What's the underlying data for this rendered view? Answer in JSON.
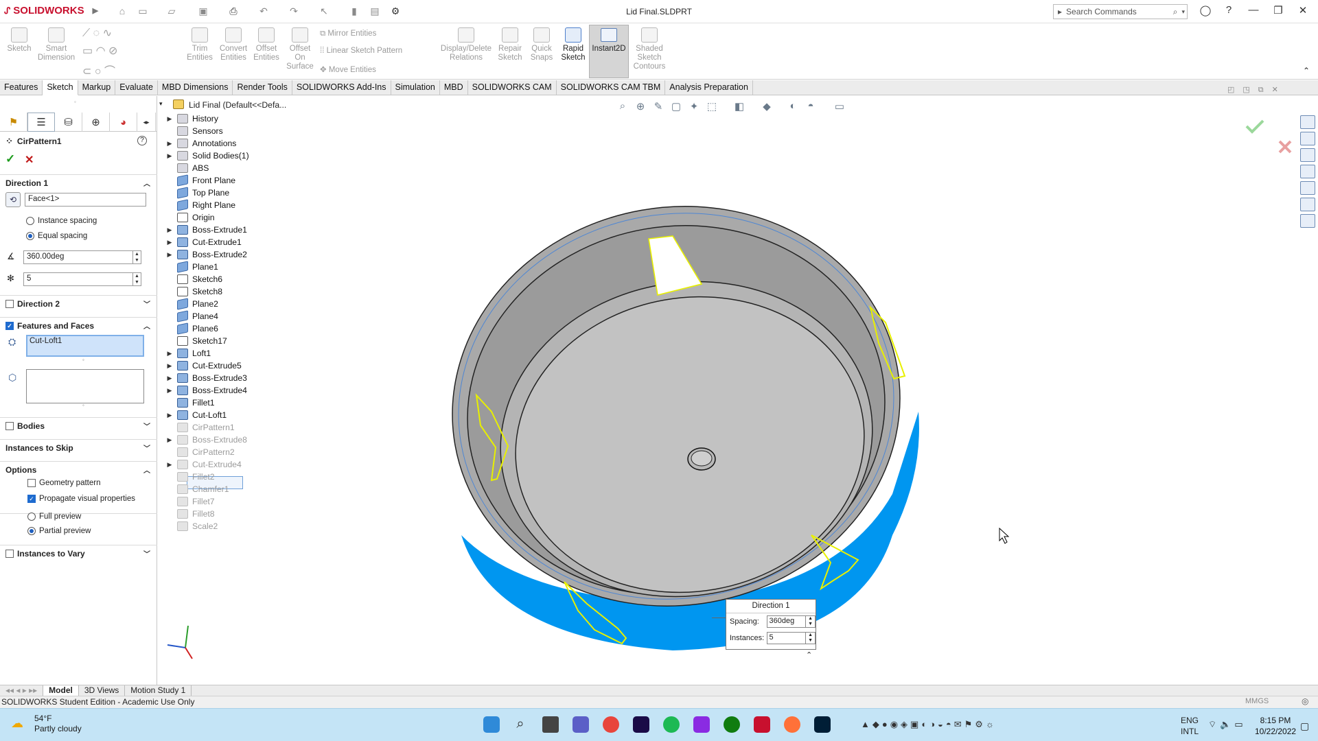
{
  "app": {
    "brand": "SOLIDWORKS",
    "title": "Lid Final.SLDPRT"
  },
  "search": {
    "placeholder": "Search Commands"
  },
  "ribbon": {
    "sketch": "Sketch",
    "smart_dimension": "Smart\nDimension",
    "trim": "Trim\nEntities",
    "convert": "Convert\nEntities",
    "offset": "Offset\nEntities",
    "offset_surface": "Offset\nOn\nSurface",
    "mirror": "Mirror Entities",
    "linear_pattern": "Linear Sketch Pattern",
    "move": "Move Entities",
    "display_delete": "Display/Delete\nRelations",
    "repair": "Repair\nSketch",
    "quick_snaps": "Quick\nSnaps",
    "rapid_sketch": "Rapid\nSketch",
    "instant2d": "Instant2D",
    "shaded": "Shaded\nSketch\nContours"
  },
  "tabs": [
    "Features",
    "Sketch",
    "Markup",
    "Evaluate",
    "MBD Dimensions",
    "Render Tools",
    "SOLIDWORKS Add-Ins",
    "Simulation",
    "MBD",
    "SOLIDWORKS CAM",
    "SOLIDWORKS CAM TBM",
    "Analysis Preparation"
  ],
  "pm": {
    "title": "CirPattern1",
    "direction1": "Direction 1",
    "axis_value": "Face<1>",
    "instance_spacing": "Instance spacing",
    "equal_spacing": "Equal spacing",
    "angle": "360.00deg",
    "instances": "5",
    "direction2": "Direction 2",
    "features_faces": "Features and Faces",
    "feature_item": "Cut-Loft1",
    "bodies": "Bodies",
    "instances_skip": "Instances to Skip",
    "options": "Options",
    "geometry_pattern": "Geometry pattern",
    "propagate": "Propagate visual properties",
    "full_preview": "Full preview",
    "partial_preview": "Partial preview",
    "instances_vary": "Instances to Vary"
  },
  "tree": {
    "root": "Lid Final  (Default<<Defa...",
    "items": [
      {
        "label": "History",
        "icon": "folder"
      },
      {
        "label": "Sensors",
        "icon": "folder"
      },
      {
        "label": "Annotations",
        "icon": "folder"
      },
      {
        "label": "Solid Bodies(1)",
        "icon": "folder"
      },
      {
        "label": "ABS",
        "icon": "folder"
      },
      {
        "label": "Front Plane",
        "icon": "plane"
      },
      {
        "label": "Top Plane",
        "icon": "plane"
      },
      {
        "label": "Right Plane",
        "icon": "plane"
      },
      {
        "label": "Origin",
        "icon": "origin"
      },
      {
        "label": "Boss-Extrude1",
        "icon": "feat"
      },
      {
        "label": "Cut-Extrude1",
        "icon": "feat"
      },
      {
        "label": "Boss-Extrude2",
        "icon": "feat"
      },
      {
        "label": "Plane1",
        "icon": "plane"
      },
      {
        "label": "Sketch6",
        "icon": "sketch"
      },
      {
        "label": "Sketch8",
        "icon": "sketch"
      },
      {
        "label": "Plane2",
        "icon": "plane"
      },
      {
        "label": "Plane4",
        "icon": "plane"
      },
      {
        "label": "Plane6",
        "icon": "plane"
      },
      {
        "label": "Sketch17",
        "icon": "sketch"
      },
      {
        "label": "Loft1",
        "icon": "feat"
      },
      {
        "label": "Cut-Extrude5",
        "icon": "feat"
      },
      {
        "label": "Boss-Extrude3",
        "icon": "feat"
      },
      {
        "label": "Boss-Extrude4",
        "icon": "feat"
      },
      {
        "label": "Fillet1",
        "icon": "feat"
      },
      {
        "label": "Cut-Loft1",
        "icon": "feat"
      },
      {
        "label": "CirPattern1",
        "icon": "dim"
      },
      {
        "label": "Boss-Extrude8",
        "icon": "dim"
      },
      {
        "label": "CirPattern2",
        "icon": "dim"
      },
      {
        "label": "Cut-Extrude4",
        "icon": "dim"
      },
      {
        "label": "Fillet2",
        "icon": "dim"
      },
      {
        "label": "Chamfer1",
        "icon": "dim"
      },
      {
        "label": "Fillet7",
        "icon": "dim"
      },
      {
        "label": "Fillet8",
        "icon": "dim"
      },
      {
        "label": "Scale2",
        "icon": "dim"
      }
    ]
  },
  "popup": {
    "title": "Direction 1",
    "spacing_label": "Spacing:",
    "spacing_value": "360deg",
    "instances_label": "Instances:",
    "instances_value": "5"
  },
  "bottom_tabs": [
    "Model",
    "3D Views",
    "Motion Study 1"
  ],
  "status": {
    "text": "SOLIDWORKS Student Edition - Academic Use Only",
    "units": "MMGS"
  },
  "taskbar": {
    "temp": "54°F",
    "weather": "Partly cloudy",
    "lang1": "ENG",
    "lang2": "INTL",
    "time": "8:15 PM",
    "date": "10/22/2022"
  },
  "colors": {
    "accent": "#1e5fbf",
    "part_blue": "#0096f0",
    "preview_yellow": "#e8f000"
  }
}
